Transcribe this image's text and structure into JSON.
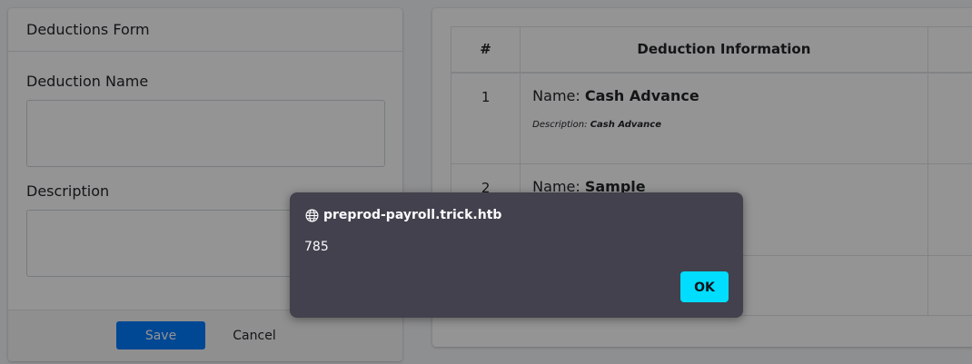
{
  "form": {
    "header": "Deductions Form",
    "name_label": "Deduction Name",
    "name_value": "",
    "description_label": "Description",
    "description_value": "",
    "save_label": "Save",
    "cancel_label": "Cancel"
  },
  "table": {
    "headers": [
      "#",
      "Deduction Information"
    ],
    "rows": [
      {
        "num": "1",
        "name_prefix": "Name:",
        "name": "Cash Advance",
        "desc_prefix": "Description:",
        "description": "Cash Advance"
      },
      {
        "num": "2",
        "name_prefix": "Name:",
        "name": "Sample",
        "desc_prefix": "",
        "description": ""
      },
      {
        "num": "",
        "name_prefix": "",
        "name": "",
        "desc_prefix": "",
        "description": ""
      }
    ]
  },
  "alert": {
    "origin": "preprod-payroll.trick.htb",
    "message": "785",
    "ok_label": "OK"
  },
  "icons": {
    "origin": "globe-icon"
  },
  "colors": {
    "save_button": "#007bff",
    "ok_button": "#00ddff",
    "dialog_background": "#42414d"
  }
}
